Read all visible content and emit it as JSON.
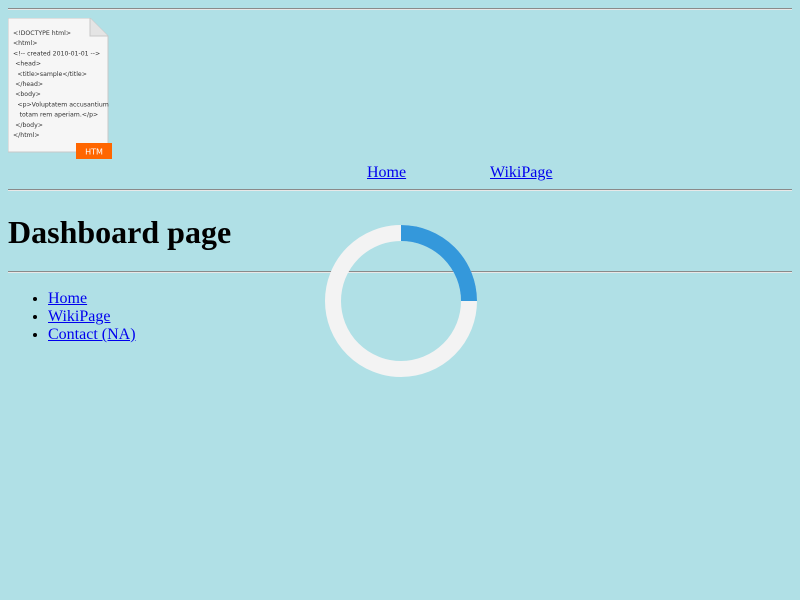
{
  "header": {
    "logo": {
      "icon": "html-file-icon",
      "code_lines": [
        "<!DOCTYPE html>",
        "<html>",
        "<!-- created 2010-01-01 -->",
        "<head>",
        "<title>sample</title>",
        "</head>",
        "<body>",
        "<p>Voluptatem accusantium",
        "totam rem aperiam.</p>",
        "</body>",
        "</html>"
      ],
      "badge": "HTM"
    },
    "nav": [
      {
        "label": "Home"
      },
      {
        "label": "WikiPage"
      }
    ]
  },
  "main": {
    "title": "Dashboard page"
  },
  "sidebar": {
    "items": [
      {
        "label": "Home"
      },
      {
        "label": "WikiPage"
      },
      {
        "label": "Contact (NA)"
      }
    ]
  },
  "loader": {
    "icon": "loading-spinner-icon",
    "progress": 0.25,
    "color_active": "#3498db",
    "color_track": "#f3f3f3"
  },
  "colors": {
    "background": "#b0e0e6",
    "link": "#0000ee",
    "badge": "#ff6600"
  }
}
